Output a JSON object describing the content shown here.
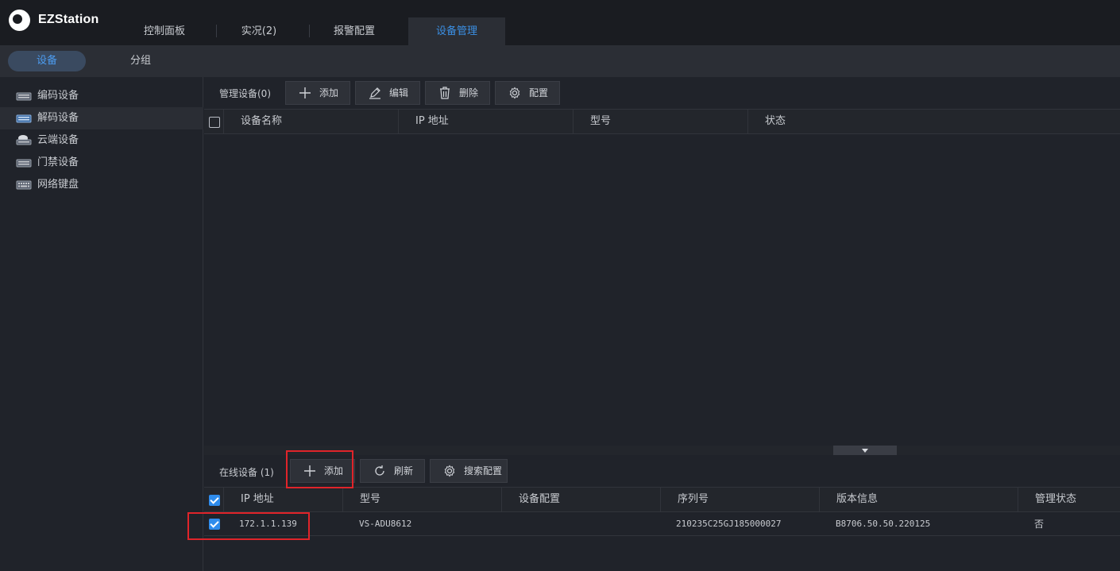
{
  "app": {
    "title": "EZStation"
  },
  "nav": {
    "tabs": [
      {
        "label": "控制面板"
      },
      {
        "label": "实况(2)"
      },
      {
        "label": "报警配置"
      },
      {
        "label": "设备管理"
      }
    ]
  },
  "subnav": {
    "tabs": [
      {
        "label": "设备"
      },
      {
        "label": "分组"
      }
    ]
  },
  "sidebar": {
    "items": [
      {
        "label": "编码设备",
        "icon": "encoder-icon"
      },
      {
        "label": "解码设备",
        "icon": "decoder-icon"
      },
      {
        "label": "云端设备",
        "icon": "cloud-device-icon"
      },
      {
        "label": "门禁设备",
        "icon": "access-control-icon"
      },
      {
        "label": "网络键盘",
        "icon": "keyboard-icon"
      }
    ]
  },
  "managed": {
    "label": "管理设备(0)",
    "buttons": {
      "add": "添加",
      "edit": "编辑",
      "delete": "删除",
      "config": "配置"
    },
    "columns": [
      "设备名称",
      "IP 地址",
      "型号",
      "状态"
    ]
  },
  "online": {
    "label": "在线设备 (1)",
    "buttons": {
      "add": "添加",
      "refresh": "刷新",
      "search_config": "搜索配置"
    },
    "columns": [
      "IP 地址",
      "型号",
      "设备配置",
      "序列号",
      "版本信息",
      "管理状态"
    ],
    "rows": [
      {
        "ip": "172.1.1.139",
        "model": "VS-ADU8612",
        "config": "",
        "serial": "210235C25GJ185000027",
        "version": "B8706.50.50.220125",
        "status": "否",
        "checked": true
      }
    ]
  },
  "colors": {
    "accent": "#3b8fe3",
    "highlight": "#e0242a"
  }
}
